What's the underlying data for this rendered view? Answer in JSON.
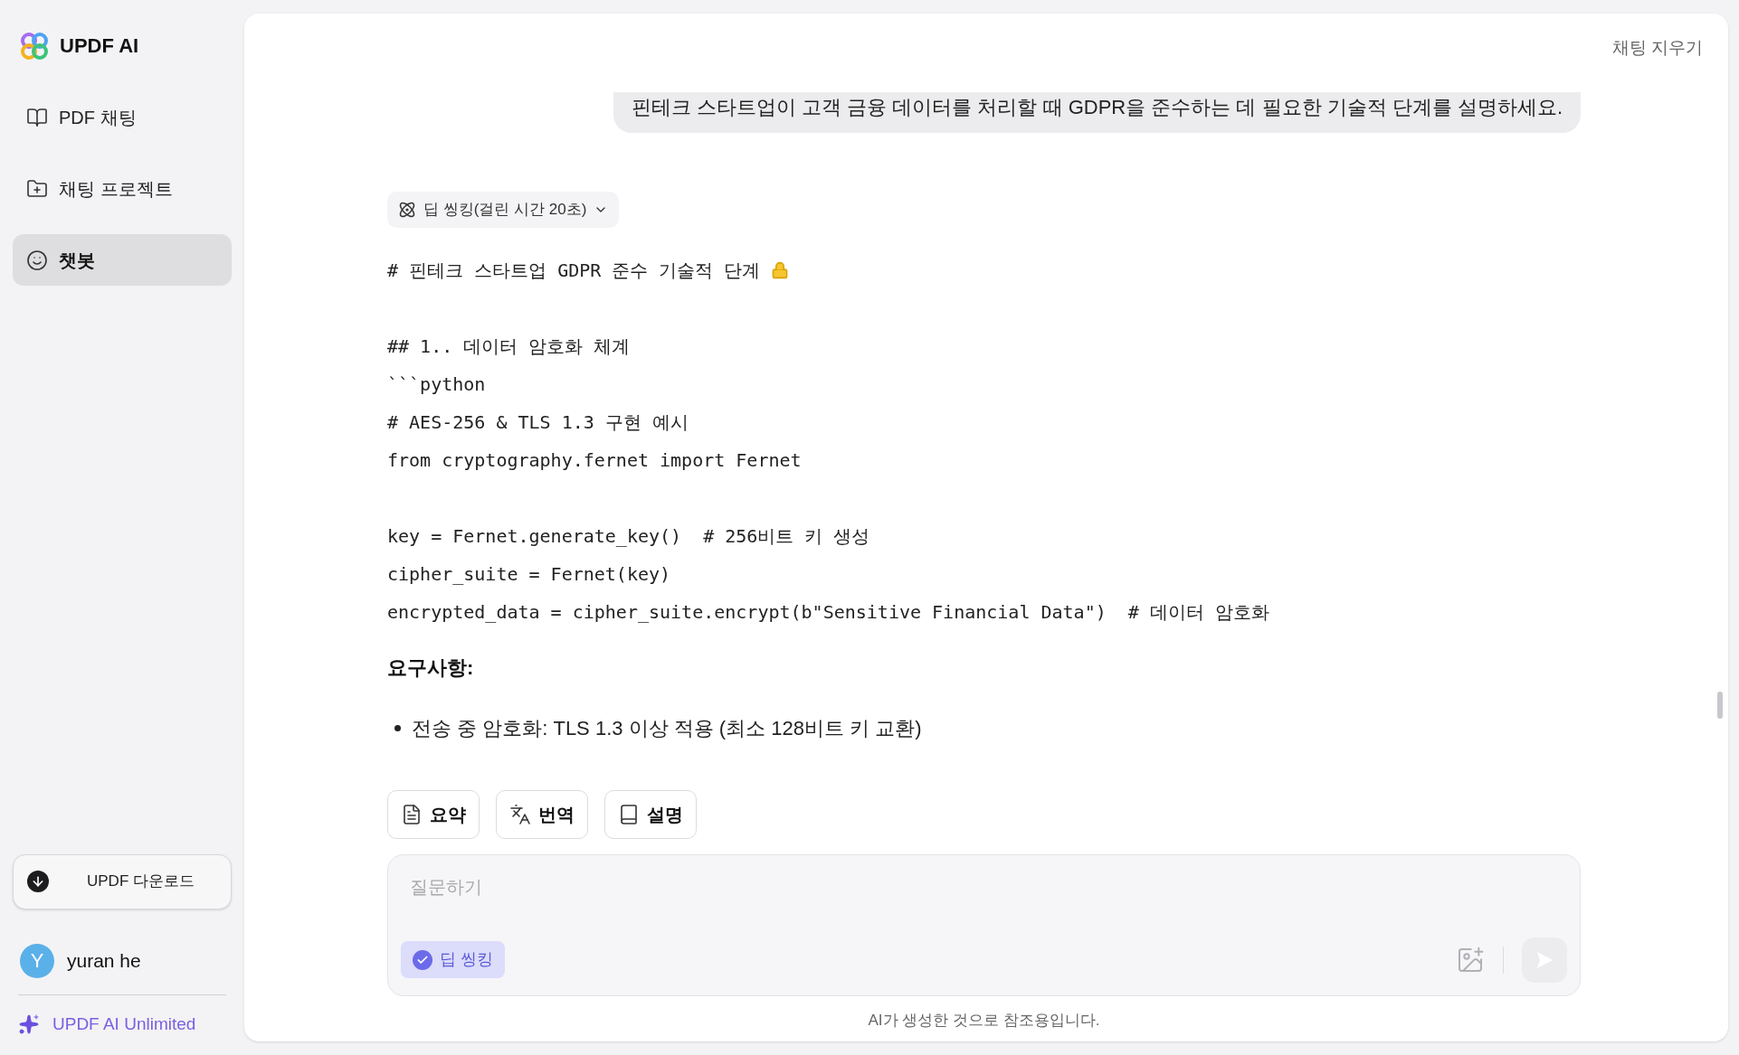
{
  "brand": {
    "name": "UPDF AI"
  },
  "nav": [
    {
      "label": "PDF 채팅",
      "selected": false,
      "kind": "book"
    },
    {
      "label": "채팅 프로젝트",
      "selected": false,
      "kind": "folder"
    },
    {
      "label": "챗봇",
      "selected": true,
      "kind": "bot"
    }
  ],
  "download_button": "UPDF 다운로드",
  "user": {
    "initial": "Y",
    "name": "yuran he"
  },
  "plan": "UPDF AI Unlimited",
  "clear_chat": "채팅 지우기",
  "user_message": "핀테크 스타트업이 고객 금융 데이터를 처리할 때 GDPR을 준수하는 데 필요한 기술적 단계를 설명하세요.",
  "thinking": {
    "label": "딥 씽킹(걸린 시간 20초)"
  },
  "code_blocks": [
    [
      "# 핀테크 스타트업 GDPR 준수 기술적 단계"
    ],
    [
      "## 1.. 데이터 암호화 체계",
      "```python",
      "# AES-256 & TLS 1.3 구현 예시",
      "from cryptography.fernet import Fernet"
    ],
    [
      "key = Fernet.generate_key()  # 256비트 키 생성",
      "cipher_suite = Fernet(key)",
      "encrypted_data = cipher_suite.encrypt(b\"Sensitive Financial Data\")  # 데이터 암호화"
    ]
  ],
  "requirements_title": "요구사항:",
  "bullets": [
    "전송 중 암호화: TLS 1.3 이상 적용 (최소 128비트 키 교환)"
  ],
  "quick_actions": [
    {
      "label": "요약",
      "kind": "summary"
    },
    {
      "label": "번역",
      "kind": "translate"
    },
    {
      "label": "설명",
      "kind": "explain"
    }
  ],
  "input": {
    "placeholder": "질문하기"
  },
  "deep_thinking_toggle": {
    "label": "딥 씽킹",
    "checked": true
  },
  "disclaimer": "AI가 생성한 것으로 참조용입니다."
}
